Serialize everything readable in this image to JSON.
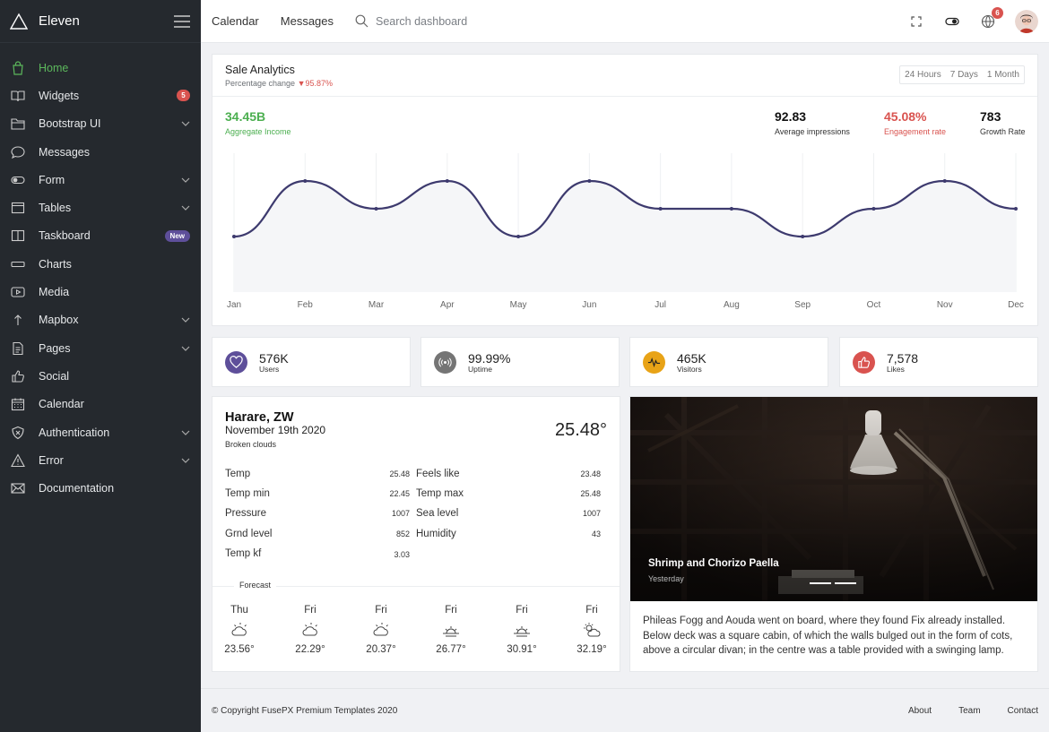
{
  "brand": {
    "name": "Eleven"
  },
  "sidebar": {
    "items": [
      {
        "label": "Home",
        "icon": "shopping-bag-icon"
      },
      {
        "label": "Widgets",
        "icon": "book-open-icon",
        "badge": "5"
      },
      {
        "label": "Bootstrap UI",
        "icon": "folder-icon"
      },
      {
        "label": "Messages",
        "icon": "chat-bubble-icon"
      },
      {
        "label": "Form",
        "icon": "toggle-icon"
      },
      {
        "label": "Tables",
        "icon": "table-icon"
      },
      {
        "label": "Taskboard",
        "icon": "columns-icon",
        "badge": "New"
      },
      {
        "label": "Charts",
        "icon": "bar-icon"
      },
      {
        "label": "Media",
        "icon": "play-icon"
      },
      {
        "label": "Mapbox",
        "icon": "arrow-up-icon"
      },
      {
        "label": "Pages",
        "icon": "document-icon"
      },
      {
        "label": "Social",
        "icon": "thumbs-up-icon"
      },
      {
        "label": "Calendar",
        "icon": "calendar-icon"
      },
      {
        "label": "Authentication",
        "icon": "shield-icon"
      },
      {
        "label": "Error",
        "icon": "warning-icon"
      },
      {
        "label": "Documentation",
        "icon": "envelope-icon"
      }
    ]
  },
  "topbar": {
    "links": [
      "Calendar",
      "Messages"
    ],
    "search_placeholder": "Search dashboard",
    "notification_count": "6"
  },
  "sale": {
    "title": "Sale Analytics",
    "subtitle": "Percentage change",
    "change": "▼95.87%",
    "ranges": [
      "24 Hours",
      "7 Days",
      "1 Month"
    ],
    "kpis": [
      {
        "value": "34.45B",
        "label": "Aggregate Income"
      },
      {
        "value": "92.83",
        "label": "Average impressions"
      },
      {
        "value": "45.08%",
        "label": "Engagement rate"
      },
      {
        "value": "783",
        "label": "Growth Rate"
      }
    ]
  },
  "chart_data": {
    "type": "area",
    "categories": [
      "Jan",
      "Feb",
      "Mar",
      "Apr",
      "May",
      "Jun",
      "Jul",
      "Aug",
      "Sep",
      "Oct",
      "Nov",
      "Dec"
    ],
    "values": [
      40,
      80,
      60,
      80,
      40,
      80,
      60,
      60,
      40,
      60,
      80,
      60
    ],
    "ylim": [
      0,
      100
    ],
    "line_color": "#3d3a6e",
    "fill_color": "#f5f6f8"
  },
  "stats": [
    {
      "value": "576K",
      "label": "Users",
      "color": "#5e4f9a",
      "icon": "heart-icon"
    },
    {
      "value": "99.99%",
      "label": "Uptime",
      "color": "#757575",
      "icon": "broadcast-icon"
    },
    {
      "value": "465K",
      "label": "Visitors",
      "color": "#e8a317",
      "icon": "pulse-icon"
    },
    {
      "value": "7,578",
      "label": "Likes",
      "color": "#d9534f",
      "icon": "thumbs-up-icon"
    }
  ],
  "weather": {
    "city": "Harare, ZW",
    "date": "November 19th 2020",
    "description": "Broken clouds",
    "temperature": "25.48°",
    "left_rows": [
      {
        "label": "Temp",
        "value": "25.48"
      },
      {
        "label": "Temp min",
        "value": "22.45"
      },
      {
        "label": "Pressure",
        "value": "1007"
      },
      {
        "label": "Grnd level",
        "value": "852"
      },
      {
        "label": "Temp kf",
        "value": "3.03"
      }
    ],
    "right_rows": [
      {
        "label": "Feels like",
        "value": "23.48"
      },
      {
        "label": "Temp max",
        "value": "25.48"
      },
      {
        "label": "Sea level",
        "value": "1007"
      },
      {
        "label": "Humidity",
        "value": "43"
      }
    ],
    "forecast_label": "Forecast",
    "forecast": [
      {
        "day": "Thu",
        "temp": "23.56°",
        "icon": "cloud-sun-icon"
      },
      {
        "day": "Fri",
        "temp": "22.29°",
        "icon": "cloud-sun-icon"
      },
      {
        "day": "Fri",
        "temp": "20.37°",
        "icon": "cloud-sun-icon"
      },
      {
        "day": "Fri",
        "temp": "26.77°",
        "icon": "sunset-icon"
      },
      {
        "day": "Fri",
        "temp": "30.91°",
        "icon": "sunset-icon"
      },
      {
        "day": "Fri",
        "temp": "32.19°",
        "icon": "sun-cloud-icon"
      }
    ]
  },
  "blog": {
    "caption": "Shrimp and Chorizo Paella",
    "caption_sub": "Yesterday",
    "text": "Phileas Fogg and Aouda went on board, where they found Fix already installed. Below deck was a square cabin, of which the walls bulged out in the form of cots, above a circular divan; in the centre was a table provided with a swinging lamp."
  },
  "footer": {
    "copyright": "© Copyright FusePX Premium Templates 2020",
    "links": [
      "About",
      "Team",
      "Contact"
    ]
  }
}
